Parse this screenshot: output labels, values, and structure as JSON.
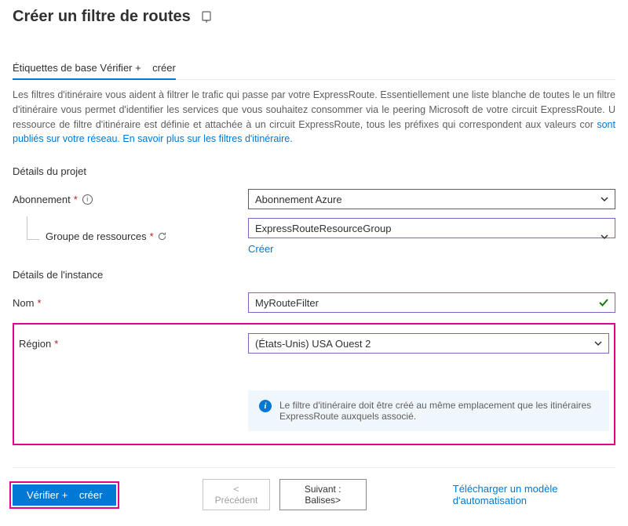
{
  "header": {
    "title": "Créer un filtre de routes"
  },
  "tabs": {
    "basics_prefix": "Étiquettes de base",
    "review_create": "Vérifier +    créer"
  },
  "description": {
    "text": "Les filtres d'itinéraire vous aident à filtrer le trafic qui passe par votre ExpressRoute. Essentiellement une liste blanche de toutes le un filtre d'itinéraire vous permet d'identifier les services que vous souhaitez consommer via le peering Microsoft de votre circuit ExpressRoute. U ressource de filtre d'itinéraire est définie et attachée à un circuit ExpressRoute, tous les préfixes qui correspondent aux valeurs cor ",
    "link": "sont publiés sur votre réseau. En savoir plus sur les filtres d'itinéraire."
  },
  "sections": {
    "project": "Détails du projet",
    "instance": "Détails de l'instance"
  },
  "labels": {
    "subscription": "Abonnement",
    "resource_group": "Groupe de ressources",
    "name": "Nom",
    "region": "Région"
  },
  "values": {
    "subscription": "Abonnement Azure",
    "resource_group": "ExpressRouteResourceGroup",
    "name": "MyRouteFilter",
    "region": "(États-Unis) USA Ouest 2"
  },
  "links": {
    "create_new": "Créer"
  },
  "banner": {
    "text": "Le filtre d'itinéraire doit être créé au même emplacement que les itinéraires ExpressRoute auxquels associé."
  },
  "footer": {
    "review": "Vérifier +    créer",
    "previous": "<  Précédent",
    "next": "Suivant : Balises>",
    "download": "Télécharger un modèle d'automatisation"
  }
}
